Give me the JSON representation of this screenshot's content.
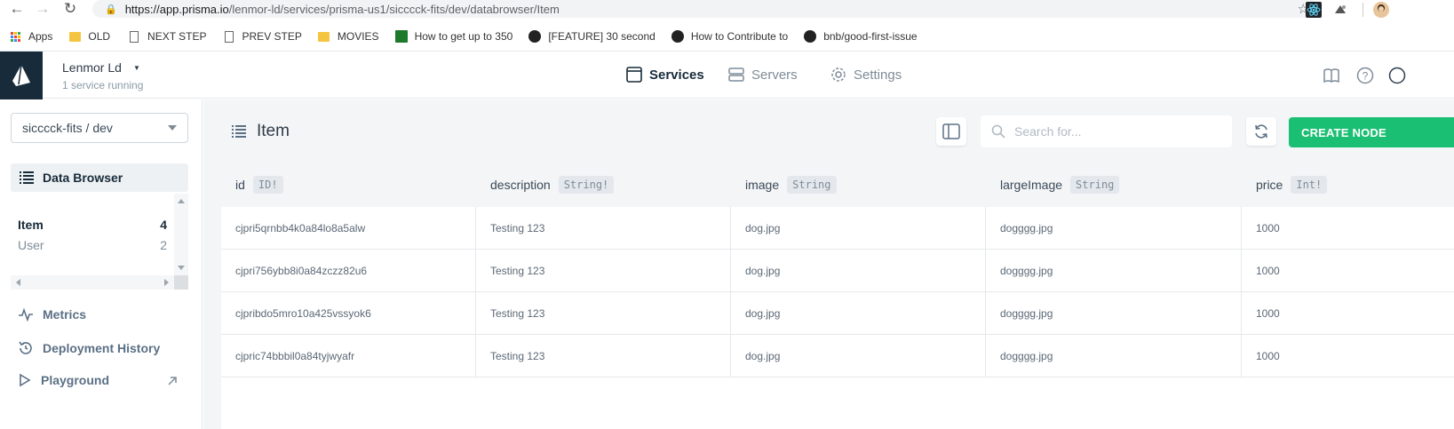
{
  "browser": {
    "url_host": "https://app.prisma.io",
    "url_path": "/lenmor-ld/services/prisma-us1/sicccck-fits/dev/databrowser/Item",
    "bookmarks": [
      {
        "label": "Apps",
        "icon": "apps-grid-icon"
      },
      {
        "label": "OLD",
        "icon": "folder-icon"
      },
      {
        "label": "NEXT STEP",
        "icon": "page-icon"
      },
      {
        "label": "PREV STEP",
        "icon": "page-icon"
      },
      {
        "label": "MOVIES",
        "icon": "folder-icon"
      },
      {
        "label": "How to get up to 350",
        "icon": "site-icon"
      },
      {
        "label": "[FEATURE] 30 second",
        "icon": "github-icon"
      },
      {
        "label": "How to Contribute to",
        "icon": "github-icon"
      },
      {
        "label": "bnb/good-first-issue",
        "icon": "github-icon"
      }
    ]
  },
  "header": {
    "workspace": "Lenmor Ld",
    "status": "1 service running",
    "nav": {
      "services": "Services",
      "servers": "Servers",
      "settings": "Settings"
    }
  },
  "sidebar": {
    "project": "sicccck-fits / dev",
    "data_browser": "Data Browser",
    "models": [
      {
        "name": "Item",
        "count": "4"
      },
      {
        "name": "User",
        "count": "2"
      }
    ],
    "links": {
      "metrics": "Metrics",
      "deployments": "Deployment History",
      "playground": "Playground"
    }
  },
  "main": {
    "title": "Item",
    "search_placeholder": "Search for...",
    "create_label": "CREATE NODE",
    "columns": [
      {
        "name": "id",
        "type": "ID!"
      },
      {
        "name": "description",
        "type": "String!"
      },
      {
        "name": "image",
        "type": "String"
      },
      {
        "name": "largeImage",
        "type": "String"
      },
      {
        "name": "price",
        "type": "Int!"
      }
    ],
    "rows": [
      [
        "cjpri5qrnbb4k0a84lo8a5alw",
        "Testing 123",
        "dog.jpg",
        "dogggg.jpg",
        "1000"
      ],
      [
        "cjpri756ybb8i0a84zczz82u6",
        "Testing 123",
        "dog.jpg",
        "dogggg.jpg",
        "1000"
      ],
      [
        "cjpribdo5mro10a425vssyok6",
        "Testing 123",
        "dog.jpg",
        "dogggg.jpg",
        "1000"
      ],
      [
        "cjpric74bbbil0a84tyjwyafr",
        "Testing 123",
        "dog.jpg",
        "dogggg.jpg",
        "1000"
      ]
    ]
  },
  "colors": {
    "accent": "#1bbf74",
    "logo_bg": "#172b3a"
  }
}
